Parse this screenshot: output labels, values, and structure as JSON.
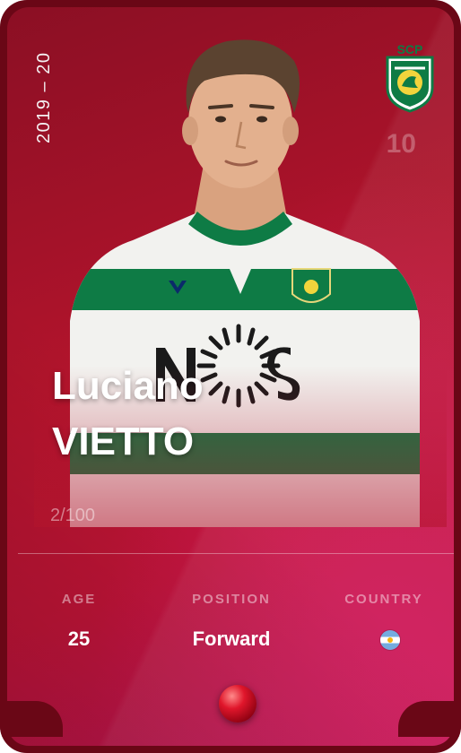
{
  "card": {
    "season": "2019 – 20",
    "jersey_number": "10",
    "club_crest_text": "SCP",
    "first_name": "Luciano",
    "last_name": "VIETTO",
    "serial": "2/100",
    "rarity_color": "#e0162b"
  },
  "stats": {
    "age_label": "AGE",
    "age_value": "25",
    "position_label": "POSITION",
    "position_value": "Forward",
    "country_label": "COUNTRY",
    "country_flag_icon": "argentina-flag-icon"
  },
  "colors": {
    "card_frame": "#6a0716",
    "card_background": "#b3142c",
    "club_green": "#0e7b45"
  }
}
